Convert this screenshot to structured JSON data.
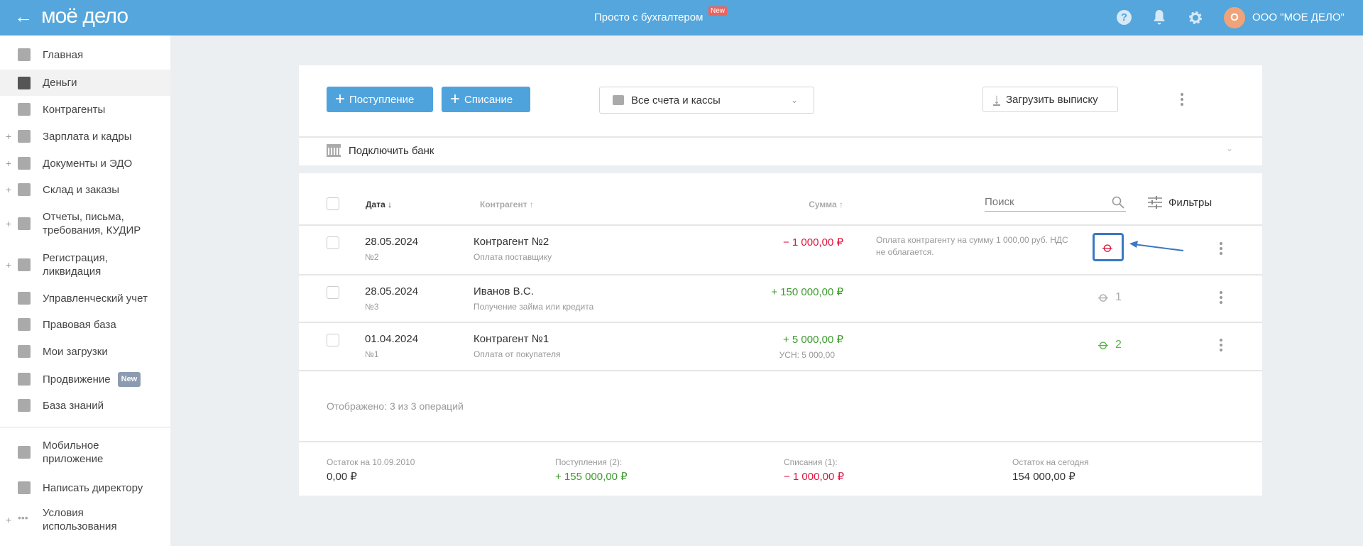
{
  "header": {
    "logo": "моё дело",
    "center_link": "Просто с бухгалтером",
    "center_badge": "New",
    "org_initial": "О",
    "org_name": "ООО \"МОЕ ДЕЛО\"",
    "icons": [
      "back-arrow-icon",
      "help-icon",
      "bell-icon",
      "gear-icon"
    ],
    "color": "#54a6dc"
  },
  "sidebar": {
    "items": [
      {
        "label": "Главная",
        "icon": "home-icon"
      },
      {
        "label": "Деньги",
        "icon": "money-icon",
        "active": true
      },
      {
        "label": "Контрагенты",
        "icon": "person-icon"
      },
      {
        "label": "Зарплата и кадры",
        "icon": "wallet-icon",
        "expandable": true
      },
      {
        "label": "Документы и ЭДО",
        "icon": "folder-icon",
        "expandable": true
      },
      {
        "label": "Склад и заказы",
        "icon": "warehouse-icon",
        "expandable": true
      },
      {
        "label": "Отчеты, письма, требования, КУДИР",
        "icon": "report-icon",
        "expandable": true
      },
      {
        "label": "Регистрация, ликвидация",
        "icon": "registration-icon",
        "expandable": true
      },
      {
        "label": "Управленческий учет",
        "icon": "ruble-icon"
      },
      {
        "label": "Правовая база",
        "icon": "briefcase-icon"
      },
      {
        "label": "Мои загрузки",
        "icon": "folder-icon"
      },
      {
        "label": "Продвижение",
        "icon": "chart-icon",
        "badge": "New"
      },
      {
        "label": "База знаний",
        "icon": "graduation-icon"
      },
      {
        "label": "Мобильное приложение",
        "icon": "phone-icon"
      },
      {
        "label": "Написать директору",
        "icon": "chat-icon"
      },
      {
        "label": "Условия использования",
        "icon": "dots-icon",
        "expandable": true
      }
    ],
    "plus": "+"
  },
  "toolbar": {
    "income": "Поступление",
    "expense": "Списание",
    "accounts": "Все счета и кассы",
    "upload": "Загрузить выписку",
    "connect_bank": "Подключить банк"
  },
  "table": {
    "headers": {
      "date": "Дата ↓",
      "contractor": "Контрагент ↑",
      "sum": "Сумма ↑"
    },
    "search_placeholder": "Поиск",
    "filters": "Фильтры",
    "rows": [
      {
        "date": "28.05.2024",
        "number": "№2",
        "contractor": "Контрагент №2",
        "purpose": "Оплата поставщику",
        "sum": "− 1 000,00 ₽",
        "type": "expense",
        "comment": "Оплата контрагенту на сумму 1 000,00 руб. НДС не облагается.",
        "attachments": "",
        "attach_color": "#e0143c",
        "highlighted": true
      },
      {
        "date": "28.05.2024",
        "number": "№3",
        "contractor": "Иванов В.С.",
        "purpose": "Получение займа или кредита",
        "sum": "+ 150 000,00 ₽",
        "type": "income",
        "comment": "",
        "attachments": "1",
        "attach_color": "#aaaaaa"
      },
      {
        "date": "01.04.2024",
        "number": "№1",
        "contractor": "Контрагент №1",
        "purpose": "Оплата от покупателя",
        "sum": "+ 5 000,00 ₽",
        "sub_sum": "УСН: 5 000,00",
        "type": "income",
        "comment": "",
        "attachments": "2",
        "attach_color": "#5cb04a"
      }
    ],
    "shown": "Отображено: 3 из 3 операций"
  },
  "footer": [
    {
      "label": "Остаток на 10.09.2010",
      "value": "0,00 ₽"
    },
    {
      "label": "Поступления (2):",
      "value": "+ 155 000,00 ₽"
    },
    {
      "label": "Списания (1):",
      "value": "− 1 000,00 ₽"
    },
    {
      "label": "Остаток на сегодня",
      "value": "154 000,00 ₽"
    }
  ]
}
